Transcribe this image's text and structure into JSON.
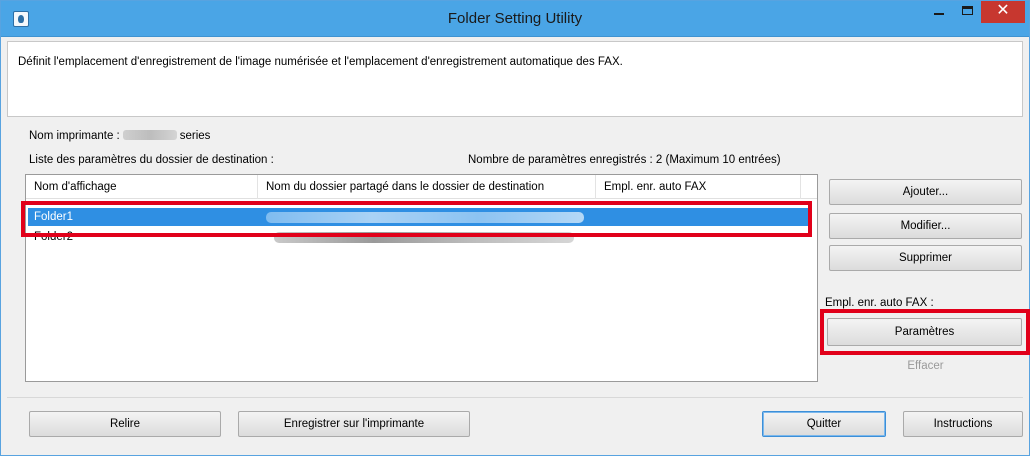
{
  "window": {
    "title": "Folder Setting Utility",
    "accent_color": "#4aa5e6",
    "close_color": "#c7372f",
    "close_glyph": "✕"
  },
  "description": "Définit l'emplacement d'enregistrement de l'image numérisée et l'emplacement d'enregistrement automatique des FAX.",
  "printer": {
    "label": "Nom imprimante :",
    "suffix": "series"
  },
  "list": {
    "label": "Liste des paramètres du dossier de destination :",
    "count_text": "Nombre de paramètres enregistrés : 2 (Maximum 10 entrées)",
    "columns": [
      "Nom d'affichage",
      "Nom du dossier partagé dans le dossier de destination",
      "Empl. enr. auto FAX"
    ],
    "rows": [
      {
        "name": "Folder1",
        "fax": "",
        "selected": true
      },
      {
        "name": "Folder2",
        "fax": "",
        "selected": false
      }
    ],
    "selection_color": "#2f8fe3"
  },
  "side_buttons": {
    "add": "Ajouter...",
    "modify": "Modifier...",
    "delete": "Supprimer",
    "fax_label": "Empl. enr. auto FAX :",
    "settings": "Paramètres",
    "clear": "Effacer"
  },
  "bottom_buttons": {
    "reload": "Relire",
    "save_to_printer": "Enregistrer sur l'imprimante",
    "quit": "Quitter",
    "instructions": "Instructions"
  },
  "highlight_color": "#e1001a"
}
